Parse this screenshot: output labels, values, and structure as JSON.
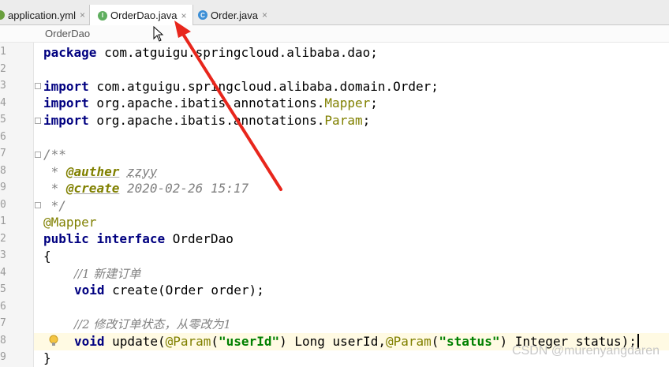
{
  "tabs": [
    {
      "label": "application.yml",
      "icon": "yml-file-icon",
      "active": false
    },
    {
      "label": "OrderDao.java",
      "icon": "interface-file-icon",
      "icon_letter": "I",
      "active": true
    },
    {
      "label": "Order.java",
      "icon": "class-file-icon",
      "icon_letter": "C",
      "active": false
    }
  ],
  "close_glyph": "×",
  "breadcrumb": "OrderDao",
  "line_numbers": [
    "1",
    "2",
    "3",
    "4",
    "5",
    "6",
    "7",
    "8",
    "9",
    "0",
    "1",
    "2",
    "3",
    "4",
    "5",
    "6",
    "7",
    "8",
    "9"
  ],
  "code": {
    "l1": {
      "kw": "package",
      "rest": " com.atguigu.springcloud.alibaba.dao;"
    },
    "l3": {
      "kw": "import",
      "rest": " com.atguigu.springcloud.alibaba.domain.Order;"
    },
    "l4": {
      "kw": "import",
      "rest": " org.apache.ibatis.annotations.",
      "cls": "Mapper",
      "end": ";"
    },
    "l5": {
      "kw": "import",
      "rest": " org.apache.ibatis.annotations.",
      "cls": "Param",
      "end": ";"
    },
    "l7": "/**",
    "l8": {
      "star": " * ",
      "tag": "@auther",
      "val": "zzyy"
    },
    "l9": {
      "star": " * ",
      "tag": "@create",
      "val": "2020-02-26 15:17"
    },
    "l10": " */",
    "l11": "@Mapper",
    "l12": {
      "kw1": "public",
      "kw2": "interface",
      "name": " OrderDao"
    },
    "l13": "{",
    "l14": "//1 新建订单",
    "l15": {
      "kw": "void",
      "rest": " create(Order order);"
    },
    "l17": "//2 修改订单状态，从零改为1",
    "l18": {
      "kw": "void",
      "fn": " update(",
      "ann1": "@Param",
      "p1": "(",
      "s1": "\"userId\"",
      "p2": ") Long userId,",
      "ann2": "@Param",
      "p3": "(",
      "s2": "\"status\"",
      "p4": ") Integer status);"
    },
    "l19": "}"
  },
  "watermark": "CSDN @murenyangdaren",
  "colors": {
    "keyword": "#000080",
    "string": "#008000",
    "annotation": "#808000",
    "comment": "#808080",
    "arrow": "#e8261c",
    "current_line": "#fffae3"
  }
}
